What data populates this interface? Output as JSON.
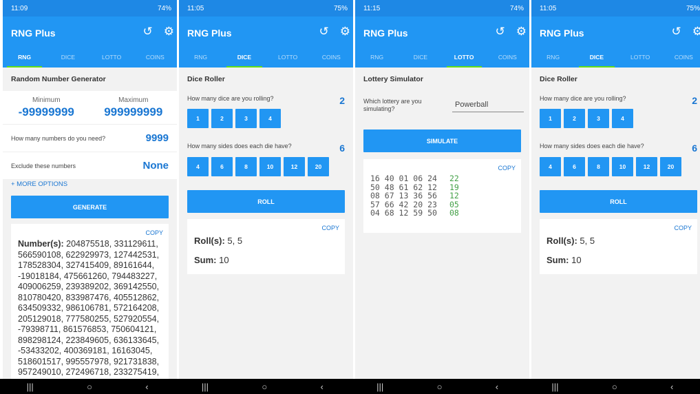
{
  "app_title": "RNG Plus",
  "tabs": [
    "RNG",
    "DICE",
    "LOTTO",
    "COINS"
  ],
  "screens": [
    {
      "status": {
        "time": "11:09",
        "battery": "74%"
      },
      "header": "Random Number Generator",
      "min_label": "Minimum",
      "min_value": "-99999999",
      "max_label": "Maximum",
      "max_value": "999999999",
      "count_question": "How many numbers do you need?",
      "count_value": "9999",
      "exclude_label": "Exclude these numbers",
      "exclude_value": "None",
      "more_options": "+ MORE OPTIONS",
      "generate": "GENERATE",
      "copy": "COPY",
      "numbers_label": "Number(s):",
      "numbers_text": "204875518, 331129611, 566590108, 622929973, 127442531, 178528304, 327415409, 89161644, -19018184, 475661260, 794483227, 409006259, 239389202, 369142550, 810780420, 833987476, 405512862, 634509332, 986106781, 572164208, 205129018, 777580255, 527920554, -79398711, 861576853, 750604121, 898298124, 223849605, 636133645, -53433202, 400369181, 16163045, 518601517, 995557978, 921731838, 957249010, 272496718, 233275419,"
    },
    {
      "status": {
        "time": "11:05",
        "battery": "75%"
      },
      "header": "Dice Roller",
      "dice_question": "How many dice are you rolling?",
      "dice_value": "2",
      "dice_options": [
        "1",
        "2",
        "3",
        "4"
      ],
      "sides_question": "How many sides does each die have?",
      "sides_value": "6",
      "sides_options": [
        "4",
        "6",
        "8",
        "10",
        "12",
        "20"
      ],
      "roll": "ROLL",
      "copy": "COPY",
      "roll_label": "Roll(s):",
      "roll_value": "5, 5",
      "sum_label": "Sum:",
      "sum_value": "10"
    },
    {
      "status": {
        "time": "11:15",
        "battery": "74%"
      },
      "header": "Lottery Simulator",
      "lottery_question": "Which lottery are you simulating?",
      "lottery_value": "Powerball",
      "simulate": "SIMULATE",
      "copy": "COPY",
      "draws": [
        {
          "main": "16 40 01 06 24",
          "powerball": "22"
        },
        {
          "main": "50 48 61 62 12",
          "powerball": "19"
        },
        {
          "main": "08 67 13 36 56",
          "powerball": "12"
        },
        {
          "main": "57 66 42 20 23",
          "powerball": "05"
        },
        {
          "main": "04 68 12 59 50",
          "powerball": "08"
        }
      ]
    },
    {
      "status": {
        "time": "11:05",
        "battery": "75%"
      },
      "header": "Dice Roller",
      "dice_question": "How many dice are you rolling?",
      "dice_value": "2",
      "dice_options": [
        "1",
        "2",
        "3",
        "4"
      ],
      "sides_question": "How many sides does each die have?",
      "sides_value": "6",
      "sides_options": [
        "4",
        "6",
        "8",
        "10",
        "12",
        "20"
      ],
      "roll": "ROLL",
      "copy": "COPY",
      "roll_label": "Roll(s):",
      "roll_value": "5, 5",
      "sum_label": "Sum:",
      "sum_value": "10"
    }
  ],
  "nav_icons": [
    "recent-apps-icon",
    "home-icon",
    "back-icon"
  ],
  "colors": {
    "primary": "#2196f3",
    "status": "#1e88e5",
    "accent": "#1976d2",
    "tab_indicator": "#64dd17",
    "powerball": "#43a047"
  }
}
